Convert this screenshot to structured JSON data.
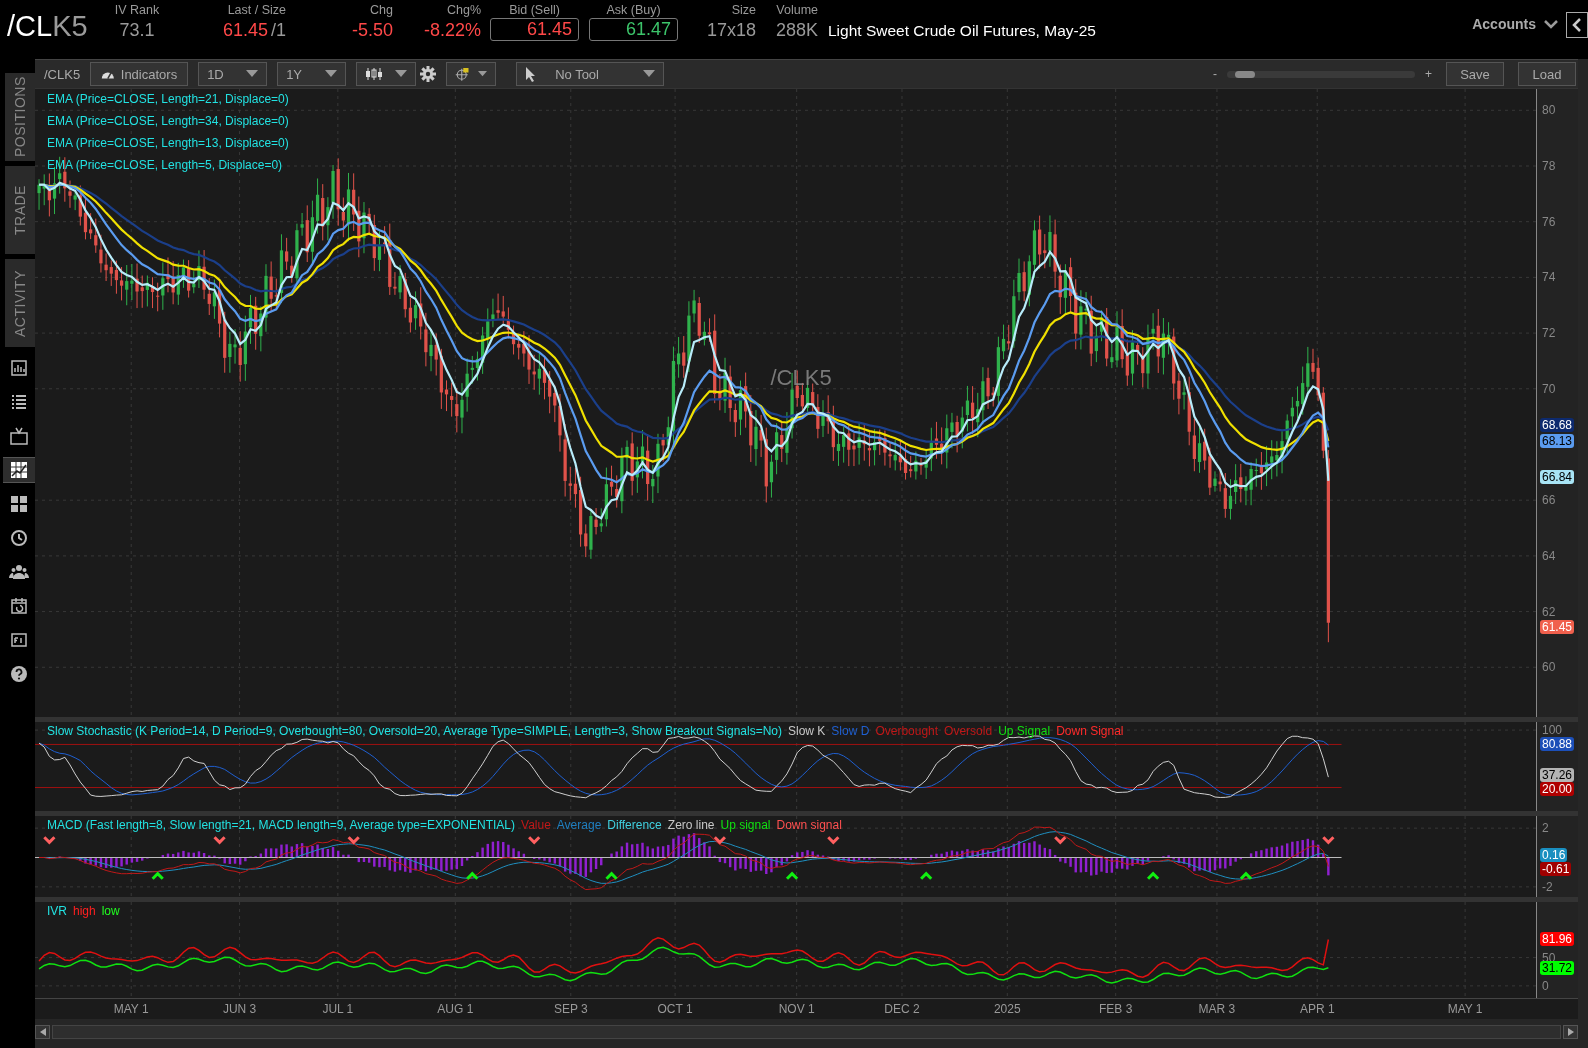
{
  "header": {
    "symbol_root": "/CL",
    "symbol_month": "K5",
    "quotes": [
      {
        "label": "IV Rank",
        "value": "73.1",
        "color": "#9a9a9a"
      },
      {
        "label": "Last / Size",
        "value": "61.45",
        "suffix": "/1",
        "color": "#ff4848"
      },
      {
        "label": "Chg",
        "value": "-5.50",
        "color": "#ff4848"
      },
      {
        "label": "Chg%",
        "value": "-8.22%",
        "color": "#ff4848"
      },
      {
        "label": "Bid (Sell)",
        "value": "61.45",
        "color": "#ff4848",
        "kind": "boxed"
      },
      {
        "label": "Ask (Buy)",
        "value": "61.47",
        "color": "#3cc46a",
        "kind": "boxed"
      },
      {
        "label": "Size",
        "value": "17x18",
        "color": "#9a9a9a"
      },
      {
        "label": "Volume",
        "value": "288K",
        "color": "#9a9a9a"
      }
    ],
    "description": "Light Sweet Crude Oil Futures, May-25",
    "accounts": "Accounts"
  },
  "sidebar": {
    "tabs": [
      "POSITIONS",
      "TRADE",
      "ACTIVITY"
    ],
    "icons": [
      {
        "kind": "report",
        "selected": false
      },
      {
        "kind": "list",
        "selected": false
      },
      {
        "kind": "tv",
        "selected": false
      },
      {
        "kind": "chart",
        "selected": true
      },
      {
        "kind": "grid",
        "selected": false
      },
      {
        "kind": "clock",
        "selected": false
      },
      {
        "kind": "people",
        "selected": false
      },
      {
        "kind": "calendar",
        "selected": false
      },
      {
        "kind": "document",
        "selected": false
      },
      {
        "kind": "help",
        "selected": false
      }
    ]
  },
  "toolbar": {
    "symbol": "/CLK5",
    "indicators": "Indicators",
    "dropdowns": [
      {
        "kind": "text",
        "value": "1D"
      },
      {
        "kind": "text",
        "value": "1Y"
      },
      {
        "kind": "candles"
      },
      {
        "kind": "drawing"
      },
      {
        "kind": "tool",
        "value": "No Tool"
      }
    ],
    "zoom_minus": "-",
    "zoom": {
      "level": 0.05
    },
    "zoom_plus": "+",
    "save": "Save",
    "load": "Load"
  },
  "price_panel": {
    "legend": [
      {
        "text": "EMA (Price=CLOSE, Length=21, Displace=0)"
      },
      {
        "text": "EMA (Price=CLOSE, Length=34, Displace=0)"
      },
      {
        "text": "EMA (Price=CLOSE, Length=13, Displace=0)"
      },
      {
        "text": "EMA (Price=CLOSE, Length=5, Displace=0)"
      }
    ],
    "watermark": "/CLK5",
    "ticks": [
      "80",
      "78",
      "76",
      "74",
      "72",
      "70",
      "66",
      "64",
      "62",
      "60"
    ],
    "badges": [
      {
        "text": "68.68",
        "color": "#0d2a6e"
      },
      {
        "text": "68.13",
        "color": "#5b9cf0"
      },
      {
        "text": "66.84",
        "color": "#a8e4f5"
      },
      {
        "text": "61.45",
        "color": "#f0604d"
      }
    ]
  },
  "stochastic_panel": {
    "title": "Slow Stochastic (K Period=14, D Period=9, Overbought=80, Oversold=20, Average Type=SIMPLE, Length=3, Show Breakout Signals=No)",
    "legend": [
      {
        "text": "Slow K",
        "color": "#c8c8c8"
      },
      {
        "text": "Slow D",
        "color": "#1f5fd0"
      },
      {
        "text": "Overbought",
        "color": "#c01818"
      },
      {
        "text": "Oversold",
        "color": "#c01818"
      },
      {
        "text": "Up Signal",
        "color": "#10e010"
      },
      {
        "text": "Down Signal",
        "color": "#ff2a2a"
      }
    ],
    "ticks": [
      "100"
    ],
    "badges": [
      {
        "text": "80.88",
        "color": "#1c4fb8"
      },
      {
        "text": "37.26",
        "color": "#b4b4b4"
      },
      {
        "text": "20.00",
        "color": "#b00000"
      }
    ]
  },
  "macd_panel": {
    "title": "MACD (Fast length=8, Slow length=21, MACD length=9, Average type=EXPONENTIAL)",
    "legend": [
      {
        "text": "Value",
        "color": "#c01818"
      },
      {
        "text": "Average",
        "color": "#1f7fc0"
      },
      {
        "text": "Difference",
        "color": "#40d0e0"
      },
      {
        "text": "Zero line",
        "color": "#c8c8c8"
      },
      {
        "text": "Up signal",
        "color": "#10e010"
      },
      {
        "text": "Down signal",
        "color": "#ff5050"
      }
    ],
    "ticks": [
      "2",
      "-2"
    ],
    "badges": [
      {
        "text": "0.16",
        "color": "#1a8fc0"
      },
      {
        "text": "-0.61",
        "color": "#a00000"
      }
    ]
  },
  "ivr_panel": {
    "title": "IVR",
    "legend": [
      {
        "text": "high",
        "color": "#ff2020"
      },
      {
        "text": "low",
        "color": "#20ff20"
      }
    ],
    "ticks": [
      "50",
      "0"
    ],
    "badges": [
      {
        "text": "81.96",
        "color": "#ff0000"
      },
      {
        "text": "31.72",
        "color": "#00ff00"
      }
    ]
  },
  "x_axis": [
    "MAY 1",
    "JUN 3",
    "JUL 1",
    "AUG 1",
    "SEP 3",
    "OCT 1",
    "NOV 1",
    "DEC 2",
    "2025",
    "FEB 3",
    "MAR 3",
    "APR 1",
    "MAY 1"
  ]
}
